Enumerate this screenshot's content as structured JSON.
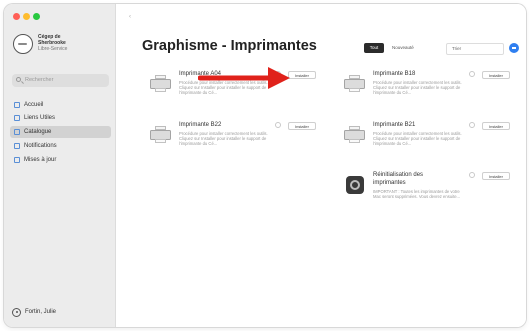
{
  "window": {
    "title": "Graphisme - Imprimantes"
  },
  "sidebar": {
    "brand_lines": [
      "Cégep de",
      "Sherbrooke",
      "Libre-Service"
    ],
    "search_placeholder": "Rechercher",
    "items": [
      {
        "label": "Accueil",
        "selected": false
      },
      {
        "label": "Liens Utiles",
        "selected": false
      },
      {
        "label": "Catalogue",
        "selected": true
      },
      {
        "label": "Notifications",
        "selected": false
      },
      {
        "label": "Mises à jour",
        "selected": false
      }
    ],
    "user": "Fortin, Julie"
  },
  "toolbar": {
    "tab_all": "Tout",
    "tab_new": "Nouveauté",
    "sort_value": "Trier",
    "sort_button_color": "#2f7ff0"
  },
  "cards": [
    {
      "name": "Imprimante A04",
      "desc": "Procédure pour installer correctement les outils. Cliquez sur Installer pour installer le support de l'imprimante du Cé...",
      "button": "Installer"
    },
    {
      "name": "Imprimante B18",
      "desc": "Procédure pour installer correctement les outils. Cliquez sur Installer pour installer le support de l'imprimante du Cé...",
      "button": "Installer"
    },
    {
      "name": "Imprimante B22",
      "desc": "Procédure pour installer correctement les outils. Cliquez sur Installer pour installer le support de l'imprimante du Cé...",
      "button": "Installer"
    },
    {
      "name": "Imprimante B21",
      "desc": "Procédure pour installer correctement les outils. Cliquez sur Installer pour installer le support de l'imprimante du Cé...",
      "button": "Installer"
    },
    {
      "name_lines": [
        "Réinitialisation des",
        "imprimantes"
      ],
      "desc": "IMPORTANT : Toutes les imprimantes de votre Mac seront supprimées. Vous devrez ensuite...",
      "button": "Installer"
    }
  ],
  "annotation": {
    "arrow_color": "#e0221b"
  }
}
